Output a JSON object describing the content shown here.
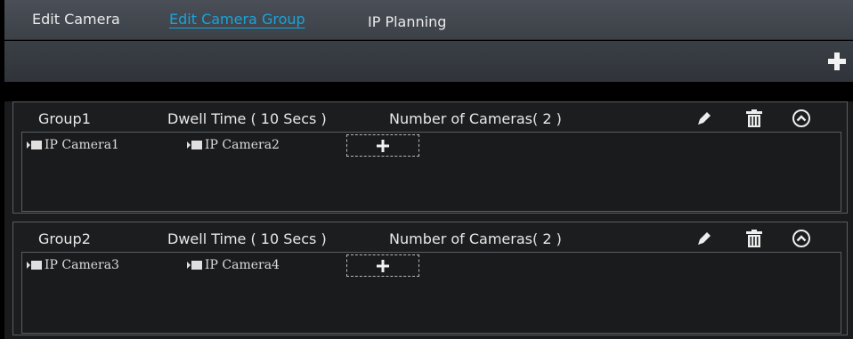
{
  "tabs": [
    {
      "label": "Edit Camera",
      "active": false
    },
    {
      "label": "Edit Camera Group",
      "active": true
    },
    {
      "label": "IP Planning",
      "active": false
    }
  ],
  "colors": {
    "tab_active": "#1aa3d9",
    "tab_bar": "#42464d",
    "content_bg": "#1a1b1d",
    "border": "#5a5d62"
  },
  "toolbar": {
    "add_icon": "plus-icon"
  },
  "groups": [
    {
      "name": "Group1",
      "dwell": "Dwell Time ( 10 Secs )",
      "count": "Number of Cameras( 2 )",
      "cameras": [
        "IP Camera1",
        "IP Camera2"
      ],
      "icons": [
        "pencil-icon",
        "trash-icon",
        "collapse-up-icon"
      ]
    },
    {
      "name": "Group2",
      "dwell": "Dwell Time ( 10 Secs )",
      "count": "Number of Cameras( 2 )",
      "cameras": [
        "IP Camera3",
        "IP Camera4"
      ],
      "icons": [
        "pencil-icon",
        "trash-icon",
        "collapse-up-icon"
      ]
    }
  ]
}
